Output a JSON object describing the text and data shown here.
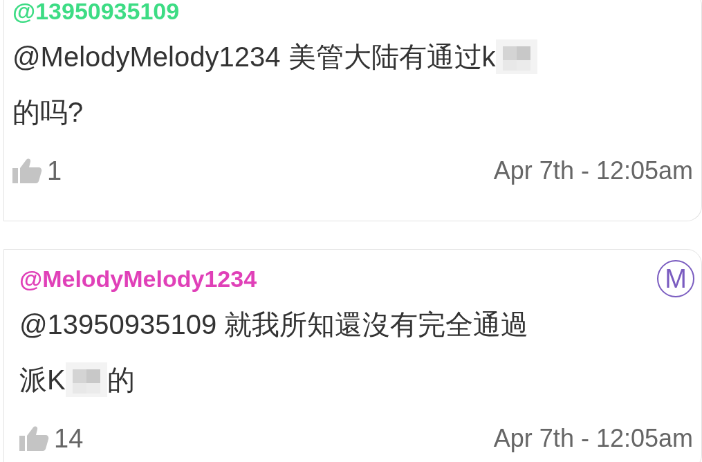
{
  "comments": [
    {
      "author": "@13950935109",
      "color": "#3ddc84",
      "lines": [
        [
          {
            "kind": "text",
            "text": "@MelodyMelody1234 美管大陆有通过k"
          },
          {
            "kind": "censor"
          }
        ],
        [
          {
            "kind": "text",
            "text": "的吗?"
          }
        ]
      ],
      "likes": "1",
      "time": "Apr 7th - 12:05am"
    },
    {
      "author": "@MelodyMelody1234",
      "color": "#e040b8",
      "badge": "M",
      "lines": [
        [
          {
            "kind": "text",
            "text": "@13950935109 就我所知還沒有完全通過"
          }
        ],
        [
          {
            "kind": "text",
            "text": "派K"
          },
          {
            "kind": "censor"
          },
          {
            "kind": "text",
            "text": "的"
          }
        ]
      ],
      "likes": "14",
      "time": "Apr 7th - 12:05am"
    }
  ]
}
